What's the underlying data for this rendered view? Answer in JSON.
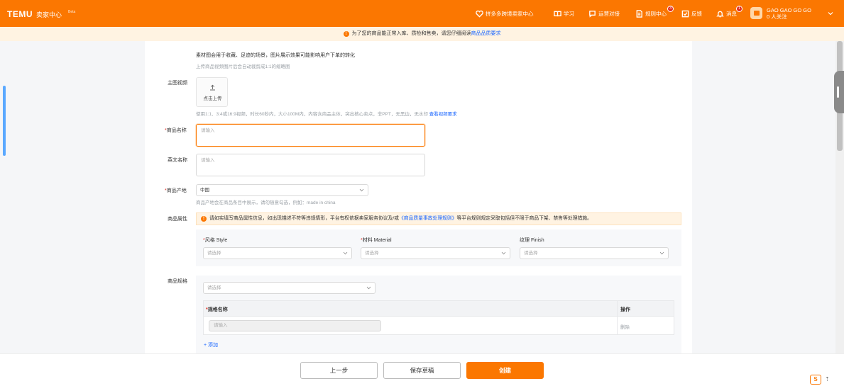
{
  "header": {
    "logo": "TEMU",
    "center_name": "卖家中心",
    "beta": "Beta",
    "nav": {
      "cross_border": "拼多多跨境卖家中心",
      "learn": "学习",
      "operations": "运营对接",
      "rules": "规则中心",
      "rules_badge": "3",
      "feedback": "反馈",
      "messages": "消息",
      "messages_badge": "1"
    },
    "user": {
      "name": "GAO GAO GO GO",
      "sub": "0 人关注"
    }
  },
  "notice": {
    "text": "为了您的商品能正常入库、质检和售卖，请您仔细阅读",
    "link": "商品品质要求"
  },
  "form": {
    "image_note": "素材图会用于收藏、足迹的场景，图片展示效果可能影响用户下单的转化",
    "image_sub_note": "上传商品视频图片后会自动裁剪成1:1的缩略图",
    "video_label": "主图视频",
    "upload_text": "点击上传",
    "video_help": "使用1:1、3:4或16:9视频，时长60秒内，大小100M内，内容含商品主体，突出核心卖点，非PPT，无黑边，无水印",
    "video_help_link": "查看视频要求",
    "name_label": "商品名称",
    "name_placeholder": "请输入",
    "en_name_label": "英文名称",
    "en_name_placeholder": "请输入",
    "origin_label": "商品产地",
    "origin_value": "中国",
    "origin_help": "商品产地会在商品条目中展示，请勿随意勾选，例如：made in china",
    "attr_label": "商品属性",
    "attr_alert_pre": "请如实填写商品属性信息，如出现描述不符等违规情形，平台有权依据卖家服务协议及/或",
    "attr_alert_link": "《商品质量事故处理规则》",
    "attr_alert_post": "等平台规则规定采取包括但不限于商品下架、禁售等处理措施。",
    "attrs": [
      {
        "label": "风格 Style",
        "placeholder": "请选择",
        "required": "*"
      },
      {
        "label": "材料 Material",
        "placeholder": "请选择",
        "required": "*"
      },
      {
        "label": "纹理 Finish",
        "placeholder": "请选择",
        "required": ""
      }
    ],
    "spec_label": "商品规格",
    "spec_placeholder": "请选择",
    "spec_table": {
      "col_name": "规格名称",
      "col_action": "操作",
      "row_placeholder": "请输入",
      "row_action": "删除"
    },
    "add_link": "+ 添加"
  },
  "footer": {
    "prev": "上一步",
    "save": "保存草稿",
    "create": "创建"
  },
  "ime": {
    "label": "S",
    "arrow": "⇡"
  },
  "colors": {
    "brand": "#fb7701",
    "link": "#1a66ff",
    "required": "#e02e24"
  }
}
